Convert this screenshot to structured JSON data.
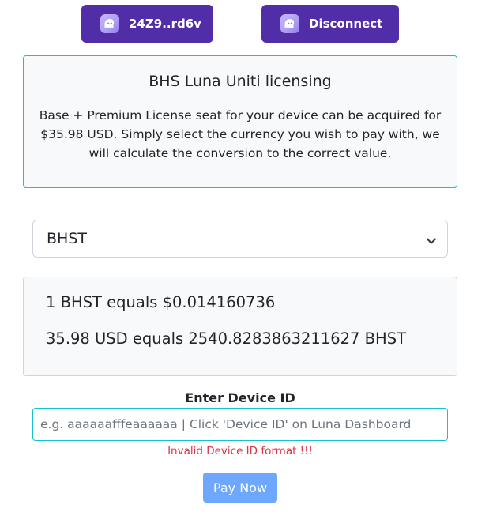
{
  "wallet": {
    "address_label": "24Z9..rd6v",
    "disconnect_label": "Disconnect",
    "icon": "phantom-ghost-icon",
    "color": "#512da8"
  },
  "info": {
    "title": "BHS Luna Uniti licensing",
    "text": "Base + Premium License seat for your device can be acquired for $35.98 USD. Simply select the currency you wish to pay with, we will calculate the conversion to the correct value."
  },
  "currency": {
    "selected": "BHST",
    "icon": "chevron-down-icon"
  },
  "conversion": {
    "rate_line": "1 BHST equals $0.014160736",
    "total_line": "35.98 USD equals 2540.8283863211627 BHST"
  },
  "device": {
    "label": "Enter Device ID",
    "value": "",
    "placeholder": "e.g. aaaaaafffeaaaaaa | Click 'Device ID' on Luna Dashboard",
    "error": "Invalid Device ID format !!!"
  },
  "pay": {
    "label": "Pay Now",
    "color": "#6ea8fe"
  }
}
